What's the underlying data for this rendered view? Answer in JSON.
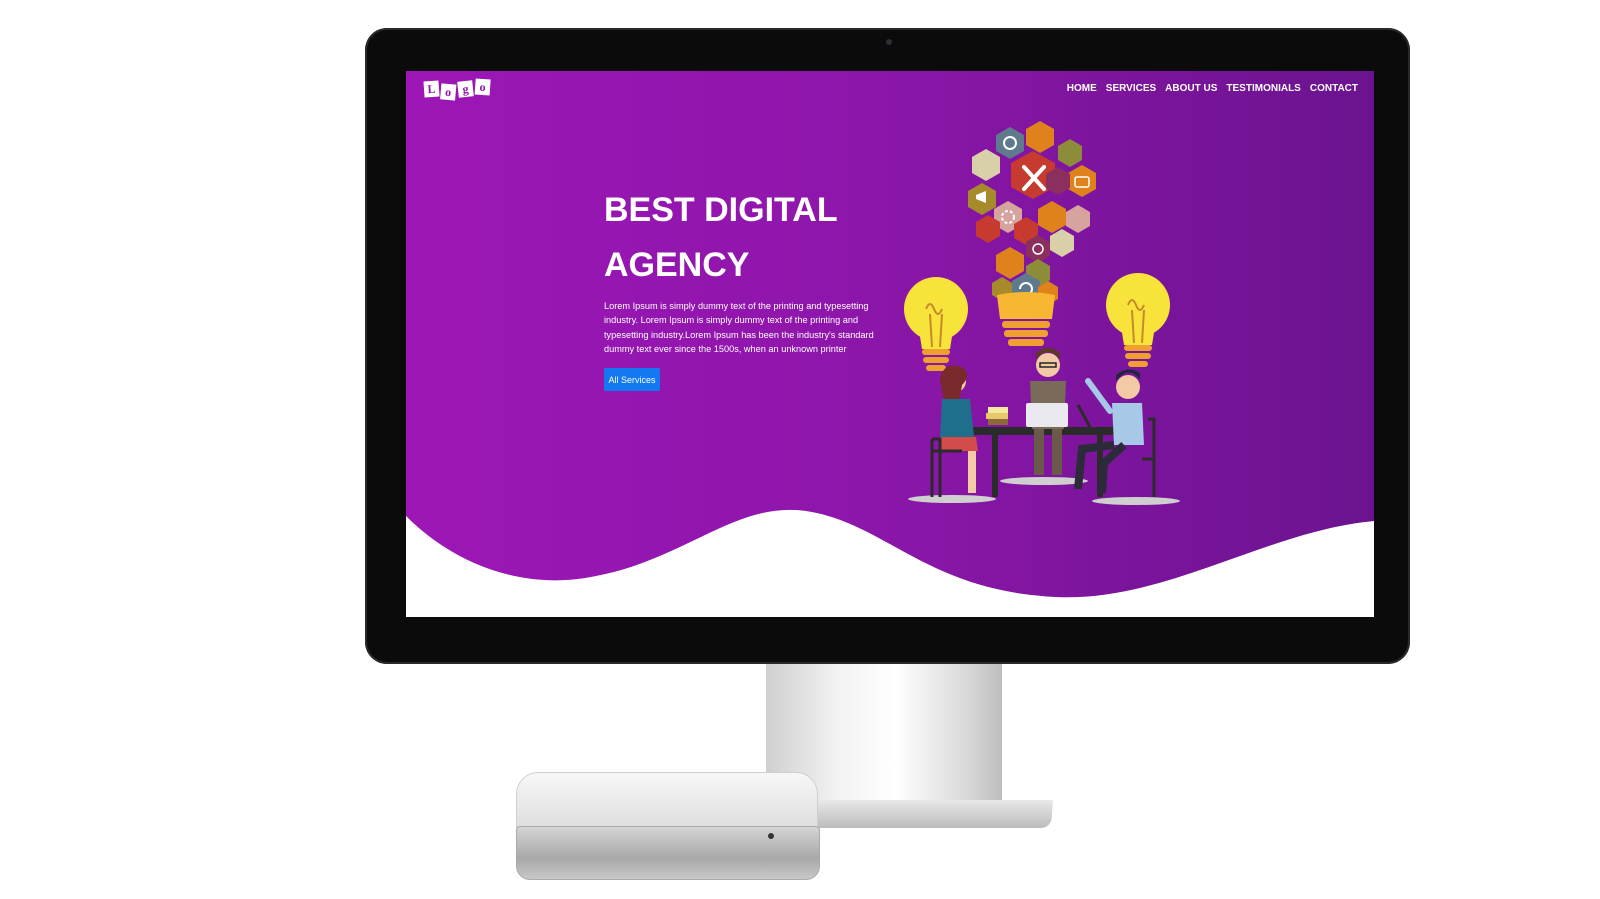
{
  "page": {
    "logo_letters": [
      "L",
      "o",
      "g",
      "o"
    ],
    "nav": [
      "HOME",
      "SERVICES",
      "ABOUT US",
      "TESTIMONIALS",
      "CONTACT"
    ],
    "hero": {
      "title_line1": "BEST DIGITAL",
      "title_line2": "AGENCY",
      "description": "Lorem Ipsum is simply dummy text of the printing and typesetting industry. Lorem Ipsum is simply dummy text of the printing and typesetting industry.Lorem Ipsum has been the industry's standard dummy text ever since the 1500s, when an unknown printer",
      "button_label": "All Services"
    }
  },
  "colors": {
    "hero_gradient_start": "#9c17b6",
    "hero_gradient_end": "#6b138f",
    "button": "#1379f0",
    "bulb": "#f7e33a"
  },
  "icons": [
    "apple-logo-icon",
    "phone-icon",
    "tools-icon",
    "chat-icon",
    "megaphone-icon",
    "gear-icon",
    "alarm-icon",
    "refresh-icon",
    "lightbulb-icon"
  ]
}
